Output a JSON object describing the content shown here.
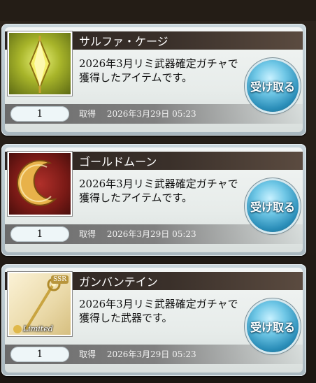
{
  "button_label": "受け取る",
  "acquired_label": "取得",
  "items": [
    {
      "name": "サルファ・ケージ",
      "description": "2026年3月リミ武器確定ガチャで獲得したアイテムです。",
      "quantity": "1",
      "acquired_at": "2026年3月29日 05:23",
      "icon": "yellow-crystal-icon"
    },
    {
      "name": "ゴールドムーン",
      "description": "2026年3月リミ武器確定ガチャで獲得したアイテムです。",
      "quantity": "1",
      "acquired_at": "2026年3月29日 05:23",
      "icon": "gold-moon-icon"
    },
    {
      "name": "ガンバンテイン",
      "description": "2026年3月リミ武器確定ガチャで獲得した武器です。",
      "quantity": "1",
      "acquired_at": "2026年3月29日 05:23",
      "icon": "staff-weapon-icon",
      "badge": "SSR",
      "tag": "Limited"
    }
  ]
}
